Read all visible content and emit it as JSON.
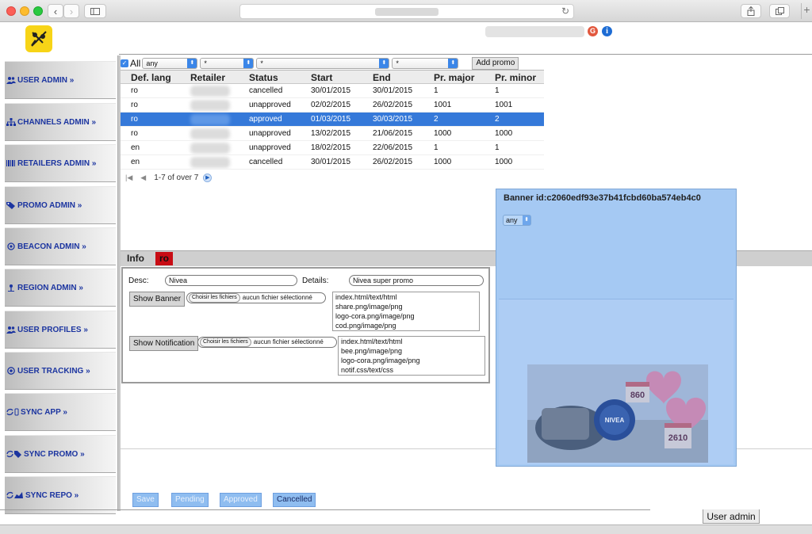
{
  "browser": {
    "back_icon": "chevron-left-icon",
    "forward_icon": "chevron-right-icon",
    "sidebar_icon": "sidebar-icon",
    "reload_icon": "reload-icon",
    "share_icon": "share-icon",
    "tabs_icon": "tabs-icon",
    "new_tab_label": "+"
  },
  "header": {
    "logout_label": "G",
    "info_label": "i"
  },
  "sidebar": {
    "items": [
      {
        "label": "USER ADMIN »",
        "icon": "users-icon"
      },
      {
        "label": "CHANNELS ADMIN »",
        "icon": "sitemap-icon"
      },
      {
        "label": "RETAILERS ADMIN »",
        "icon": "barcode-icon"
      },
      {
        "label": "PROMO ADMIN »",
        "icon": "tag-icon"
      },
      {
        "label": "BEACON ADMIN »",
        "icon": "beacon-icon"
      },
      {
        "label": "REGION ADMIN »",
        "icon": "pin-icon"
      },
      {
        "label": "USER PROFILES »",
        "icon": "users-icon"
      },
      {
        "label": "USER TRACKING »",
        "icon": "target-icon"
      },
      {
        "label": "SYNC APP »",
        "icon": "sync-mobile-icon"
      },
      {
        "label": "SYNC PROMO »",
        "icon": "sync-tag-icon"
      },
      {
        "label": "SYNC REPO »",
        "icon": "sync-chart-icon"
      }
    ]
  },
  "filter": {
    "all_label": "All",
    "lang_value": "any",
    "retailer_value": "*",
    "channel_value": "*",
    "status_value": "*",
    "add_promo_label": "Add promo"
  },
  "grid": {
    "columns": [
      "Def. lang",
      "Retailer",
      "Status",
      "Start",
      "End",
      "Pr. major",
      "Pr. minor"
    ],
    "rows": [
      {
        "lang": "ro",
        "status": "cancelled",
        "start": "30/01/2015",
        "end": "30/01/2015",
        "major": "1",
        "minor": "1"
      },
      {
        "lang": "ro",
        "status": "unapproved",
        "start": "02/02/2015",
        "end": "26/02/2015",
        "major": "1001",
        "minor": "1001"
      },
      {
        "lang": "ro",
        "status": "approved",
        "start": "01/03/2015",
        "end": "30/03/2015",
        "major": "2",
        "minor": "2"
      },
      {
        "lang": "ro",
        "status": "unapproved",
        "start": "13/02/2015",
        "end": "21/06/2015",
        "major": "1000",
        "minor": "1000"
      },
      {
        "lang": "en",
        "status": "unapproved",
        "start": "18/02/2015",
        "end": "22/06/2015",
        "major": "1",
        "minor": "1"
      },
      {
        "lang": "en",
        "status": "cancelled",
        "start": "30/01/2015",
        "end": "26/02/2015",
        "major": "1000",
        "minor": "1000"
      }
    ],
    "selected_row": 2,
    "pager_text": "1-7 of over 7"
  },
  "detail": {
    "tab_info": "Info",
    "tab_lang": "ro",
    "desc_label": "Desc:",
    "desc_value": "Nivea",
    "details_label": "Details:",
    "details_value": "Nivea super promo",
    "show_banner_label": "Show Banner",
    "show_notification_label": "Show Notification",
    "choose_files_label": "Choisir les fichiers",
    "no_file_label": "aucun fichier sélectionné",
    "banner_files": [
      "index.html/text/html",
      "share.png/image/png",
      "logo-cora.png/image/png",
      "cod.png/image/png"
    ],
    "notification_files": [
      "index.html/text/html",
      "bee.png/image/png",
      "logo-cora.png/image/png",
      "notif.css/text/css"
    ]
  },
  "actions": {
    "save": "Save",
    "pending": "Pending",
    "approved": "Approved",
    "cancelled": "Cancelled"
  },
  "banner": {
    "title": "Banner id:c2060edf93e37b41fcbd60ba574eb4c0",
    "select_value": "any",
    "price_top": "860",
    "price_bottom": "2610",
    "brand": "NIVEA"
  },
  "footer": {
    "user_admin_tab": "User admin"
  },
  "colors": {
    "accent": "#3579d9",
    "sidebar_text": "#1c35a0",
    "lang_tab": "#c80d15",
    "banner_overlay": "#a5c9f3"
  }
}
